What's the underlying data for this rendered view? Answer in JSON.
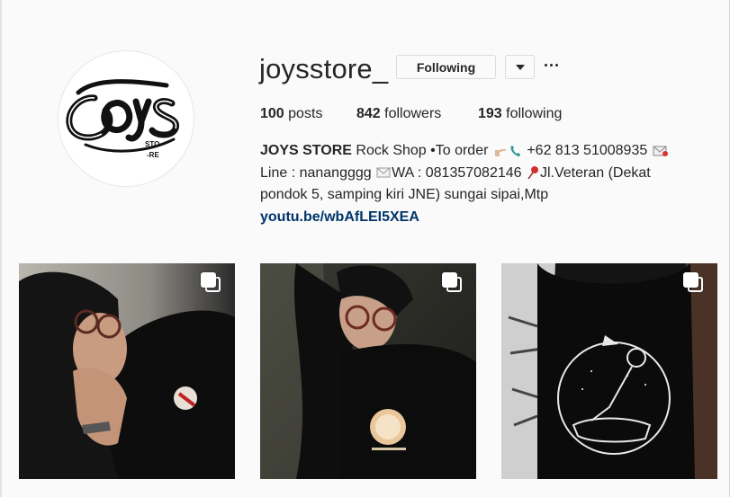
{
  "profile": {
    "username": "joysstore_",
    "following_button": "Following",
    "avatar_lettering": "JOYS STO-RE"
  },
  "stats": {
    "posts_count": "100",
    "posts_label": " posts",
    "followers_count": "842",
    "followers_label": " followers",
    "following_count": "193",
    "following_label": " following"
  },
  "bio": {
    "name": "JOYS STORE",
    "text_1": " Rock Shop •To order ",
    "text_2": " +62 813 51008935 ",
    "text_3": "Line : nanangggg ",
    "text_4": "WA : 081357082146 ",
    "text_5": "Jl.Veteran (Dekat pondok 5, samping kiri JNE) sungai sipai,Mtp",
    "link": "youtu.be/wbAfLEI5XEA"
  },
  "icons": {
    "dropdown": "chevron-down-icon",
    "more": "more-options-icon",
    "hand": "pointing-hand-emoji",
    "phone": "phone-emoji",
    "envelope_red": "envelope-with-heart-emoji",
    "envelope": "envelope-emoji",
    "pin": "round-pushpin-emoji",
    "carousel": "multiple-posts-icon"
  },
  "colors": {
    "link": "#003569",
    "text": "#262626",
    "background": "#fafafa"
  }
}
